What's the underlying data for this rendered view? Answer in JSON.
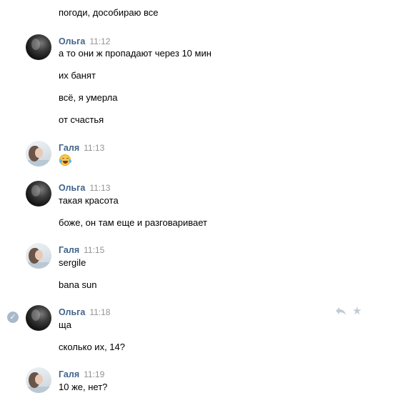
{
  "messages": {
    "pre": {
      "line_0": "погоди, дособираю все"
    },
    "g1": {
      "author": "Ольга",
      "time": "11:12",
      "line_0": "а то они ж пропадают через 10 мин",
      "line_1": "их банят",
      "line_2": "всё, я умерла",
      "line_3": "от счастья"
    },
    "g2": {
      "author": "Галя",
      "time": "11:13",
      "emoji": "face-with-tears-of-joy"
    },
    "g3": {
      "author": "Ольга",
      "time": "11:13",
      "line_0": "такая красота",
      "line_1": "боже, он там еще и разговаривает"
    },
    "g4": {
      "author": "Галя",
      "time": "11:15",
      "line_0": "sergile",
      "line_1": "bana sun"
    },
    "g5": {
      "author": "Ольга",
      "time": "11:18",
      "line_0": "ща",
      "line_1": "сколько их, 14?"
    },
    "g6": {
      "author": "Галя",
      "time": "11:19",
      "line_0": "10 же, нет?"
    }
  },
  "icons": {
    "selected_check": "check-icon",
    "reply": "reply-icon",
    "favorite": "star-icon"
  },
  "colors": {
    "author": "#42648b",
    "time": "#939393",
    "action_icons": "#c2cad6",
    "selected_check": "#a8b9cc"
  }
}
